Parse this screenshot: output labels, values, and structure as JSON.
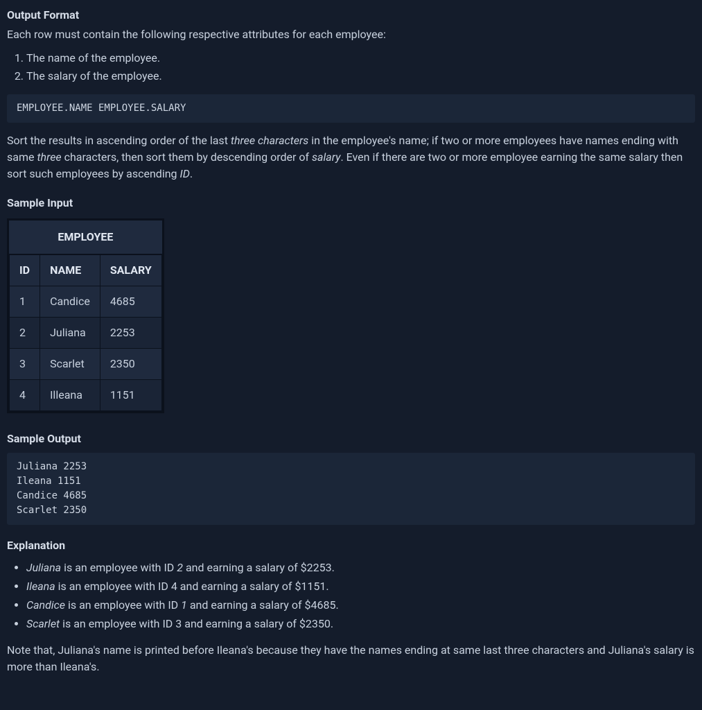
{
  "headings": {
    "output_format": "Output Format",
    "sample_input": "Sample Input",
    "sample_output": "Sample Output",
    "explanation": "Explanation"
  },
  "output_format": {
    "intro": "Each row must contain the following respective attributes for each employee:",
    "items": [
      "The name of the employee.",
      "The salary of the employee."
    ],
    "code": "EMPLOYEE.NAME EMPLOYEE.SALARY",
    "sort_paragraph": {
      "p1": "Sort the results in ascending order of the last ",
      "i1": "three characters",
      "p2": " in the employee's name; if two or more employees have names ending with same ",
      "i2": "three",
      "p3": " characters, then sort them by descending order of ",
      "i3": "salary",
      "p4": ". Even if there are two or more employee earning the same salary then sort such employees by ascending ",
      "i4": "ID",
      "p5": "."
    }
  },
  "sample_input": {
    "table_caption": "EMPLOYEE",
    "columns": [
      "ID",
      "NAME",
      "SALARY"
    ],
    "rows": [
      {
        "id": "1",
        "name": "Candice",
        "salary": "4685"
      },
      {
        "id": "2",
        "name": "Juliana",
        "salary": "2253"
      },
      {
        "id": "3",
        "name": "Scarlet",
        "salary": "2350"
      },
      {
        "id": "4",
        "name": "Illeana",
        "salary": "1151"
      }
    ]
  },
  "sample_output": {
    "code": "Juliana 2253\nIleana 1151\nCandice 4685\nScarlet 2350"
  },
  "explanation": {
    "items": [
      {
        "name": "Juliana",
        "t1": " is an employee with ID ",
        "id": "2",
        "id_italic": true,
        "t2": " and earning a salary of $2253."
      },
      {
        "name": "Ileana",
        "t1": " is an employee with ID 4 and earning a salary of $1151.",
        "id": "",
        "id_italic": false,
        "t2": ""
      },
      {
        "name": "Candice",
        "t1": " is an employee with ID ",
        "id": "1",
        "id_italic": true,
        "t2": " and earning a salary of $4685."
      },
      {
        "name": "Scarlet",
        "t1": " is an employee with ID 3 and earning a salary of $2350.",
        "id": "",
        "id_italic": false,
        "t2": ""
      }
    ],
    "note": "Note that, Juliana's name is printed before Ileana's because they have the names ending at same last three characters and Juliana's salary is more than Ileana's."
  }
}
